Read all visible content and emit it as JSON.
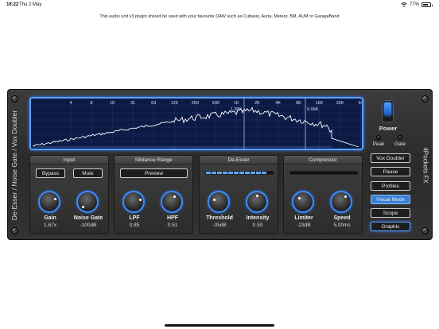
{
  "status_bar": {
    "time": "16:22",
    "date": "Thu 2 May",
    "battery": "77%",
    "battery_level": 0.77
  },
  "info_text": "This audio unit v3 plugin should be used with your favourite DAW such as Cubasis, Auria, Meteor, BM, AUM or GarageBand",
  "plugin": {
    "left_label": "De-Esser / Noise Gate / Vox Doubler",
    "right_label": "4Pockets FX",
    "colors": {
      "accent": "#3a8cff",
      "graph_bg": "#0c1a44"
    }
  },
  "graph": {
    "freq_labels": [
      "4",
      "8",
      "16",
      "31",
      "63",
      "125",
      "250",
      "500",
      "1K",
      "2K",
      "4K",
      "8K",
      "16K",
      "32K",
      "64"
    ],
    "marker_low": "1.28K",
    "marker_high": "9.99K"
  },
  "input": {
    "title": "Input",
    "bypass_label": "Bypass",
    "mute_label": "Mute",
    "gain_label": "Gain",
    "gain_value": "1.67x",
    "noise_gate_label": "Noise Gate",
    "noise_gate_value": "-100dB"
  },
  "sibilance": {
    "title": "Sibilance Range",
    "preview_label": "Preview",
    "lpf_label": "LPF",
    "lpf_value": "0.85",
    "hpf_label": "HPF",
    "hpf_value": "0.51"
  },
  "deesser": {
    "title": "De-Esser",
    "meter_level": 0.92,
    "threshold_label": "Threshold",
    "threshold_value": "-35dB",
    "intensity_label": "Intensity",
    "intensity_value": "0.50"
  },
  "compressor": {
    "title": "Compressor",
    "meter_level": 0.0,
    "limiter_label": "Limiter",
    "limiter_value": "-23dB",
    "speed_label": "Speed",
    "speed_value": "5.00ms"
  },
  "right_panel": {
    "power_label": "Power",
    "peak_label": "Peak",
    "gate_label": "Gate",
    "buttons": {
      "vox_doubler": "Vox Doubler",
      "pause": "Pause",
      "profiles": "Profiles",
      "visual_mode": "Visual Mode",
      "scope": "Scope",
      "graphic": "Graphic"
    }
  }
}
